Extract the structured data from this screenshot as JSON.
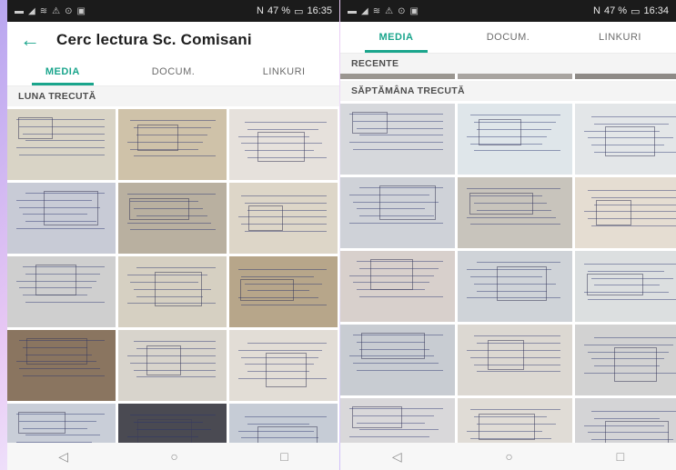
{
  "left": {
    "status": {
      "time": "16:35",
      "battery": "47 %",
      "signal": "N"
    },
    "app_title": "Cerc lectura Sc. Comisani",
    "tabs": [
      "MEDIA",
      "DOCUM.",
      "LINKURI"
    ],
    "section_label": "LUNA TRECUTĂ"
  },
  "right": {
    "status": {
      "time": "16:34",
      "battery": "47 %",
      "signal": "N"
    },
    "tabs": [
      "MEDIA",
      "DOCUM.",
      "LINKURI"
    ],
    "section_recent": "RECENTE",
    "section_label": "SĂPTĂMÂNA TRECUTĂ"
  },
  "nav": {
    "back": "◁",
    "home": "○",
    "recents": "□"
  },
  "colors": {
    "accent": "#1aa58c"
  }
}
